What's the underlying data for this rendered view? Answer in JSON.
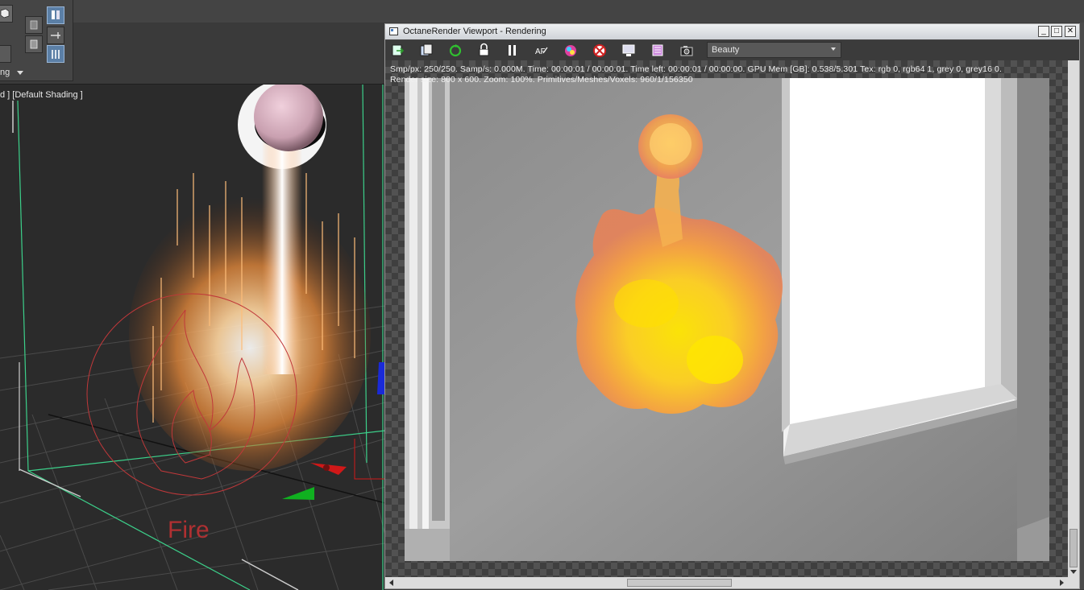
{
  "max": {
    "shading_dropdown_label": "ng",
    "viewport_label": "d ] [Default Shading ]",
    "fire_gizmo_label": "Fire"
  },
  "octane": {
    "title": "OctaneRender Viewport - Rendering",
    "window_buttons": {
      "minimize": "_",
      "maximize": "□",
      "close": "✕"
    },
    "render_pass": "Beauty",
    "stats_line1": "Smp/px: 250/250.    Samp/s: 0.000M.    Time: 00:00:01 / 00:00:01.    Time left: 00:00:01 / 00:00:00.    GPU Mem [GB]: 0.538/5.301    Tex: rgb 0, rgb64 1, grey 0, grey16 0.",
    "stats_line2": "Render size: 800 x 600.    Zoom: 100%.    Primitives/Meshes/Voxels: 960/1/156350",
    "toolbar_icons": [
      "export-render-icon",
      "copy-to-clipboard-icon",
      "restart-render-icon",
      "lock-icon",
      "pause-icon",
      "auto-focus-icon",
      "color-picker-icon",
      "clear-region-icon",
      "render-region-icon",
      "film-region-icon",
      "camera-icon"
    ]
  },
  "colors": {
    "accent_selection": "#5b7fa6",
    "fire_core": "#ffe600",
    "fire_edge": "#f08050",
    "grid_green": "#3cd08a"
  }
}
